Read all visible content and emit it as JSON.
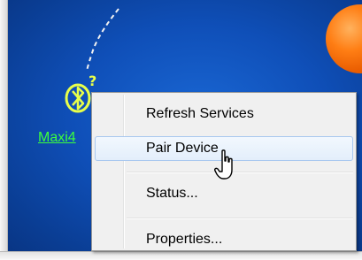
{
  "device": {
    "label": "Maxi4"
  },
  "context_menu": {
    "items": [
      {
        "label": "Refresh Services"
      },
      {
        "label": "Pair Device"
      },
      {
        "label": "Status..."
      },
      {
        "label": "Properties..."
      }
    ]
  },
  "colors": {
    "desktop_blue": "#1a67d4",
    "device_green": "#3cff3c",
    "icon_yellow": "#e8ff4a",
    "orb_orange": "#ff7e14",
    "menu_highlight": "#e3eefb"
  },
  "icons": {
    "device": "bluetooth-icon",
    "status": "question-mark-icon",
    "pointer": "mouse-cursor-icon"
  }
}
